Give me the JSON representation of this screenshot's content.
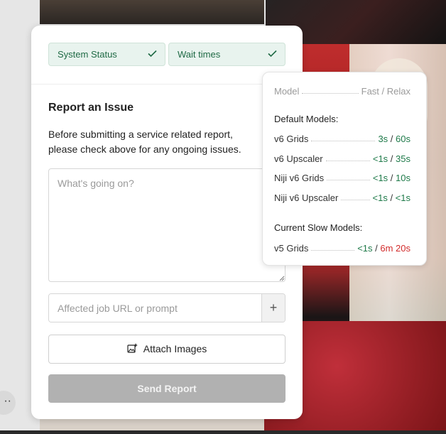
{
  "status_pills": [
    {
      "label": "System Status",
      "icon": "check-icon"
    },
    {
      "label": "Wait times",
      "icon": "check-icon"
    }
  ],
  "report": {
    "title": "Report an Issue",
    "description": "Before submitting a service related report, please check above for any ongoing issues.",
    "issue_placeholder": "What's going on?",
    "url_placeholder": "Affected job URL or prompt",
    "add_label": "+",
    "attach_label": "Attach Images",
    "send_label": "Send Report"
  },
  "wait_times": {
    "header": {
      "left": "Model",
      "right": "Fast / Relax"
    },
    "default_title": "Default Models:",
    "default_models": [
      {
        "name": "v6 Grids",
        "fast": "3s",
        "relax": "60s"
      },
      {
        "name": "v6 Upscaler",
        "fast": "<1s",
        "relax": "35s"
      },
      {
        "name": "Niji v6 Grids",
        "fast": "<1s",
        "relax": "10s"
      },
      {
        "name": "Niji v6 Upscaler",
        "fast": "<1s",
        "relax": "<1s"
      }
    ],
    "slow_title": "Current Slow Models:",
    "slow_models": [
      {
        "name": "v5 Grids",
        "fast": "<1s",
        "relax": "6m 20s"
      }
    ]
  },
  "colors": {
    "status_green": "#1f6a45",
    "fast_green": "#1f7a4a",
    "slow_red": "#d22b2b",
    "send_disabled": "#b1b1b1"
  },
  "left_more_label": "··"
}
